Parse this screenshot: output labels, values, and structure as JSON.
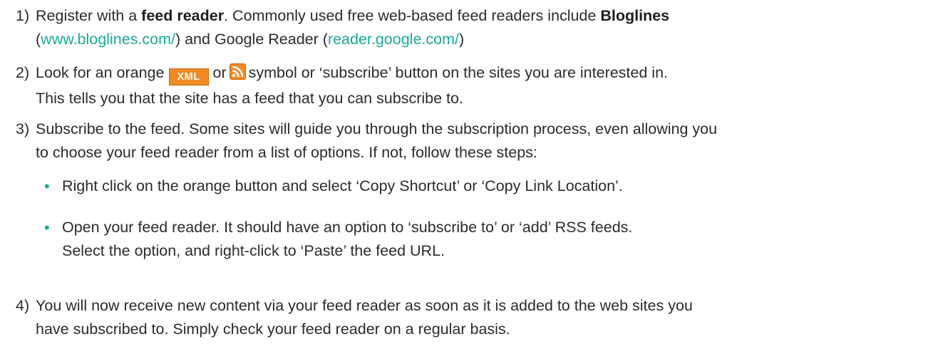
{
  "steps": [
    {
      "number": "1)",
      "line1_a": "Register with a ",
      "line1_b": "feed reader",
      "line1_c": ". Commonly used free web-based feed readers include ",
      "line1_d": "Bloglines",
      "line2_a": "(",
      "link1": "www.bloglines.com/",
      "line2_b": ") and Google Reader (",
      "link2": "reader.google.com/",
      "line2_c": ")"
    },
    {
      "number": "2)",
      "line1_a": "Look for an orange",
      "xml_badge": "XML",
      "line1_b": "or",
      "line1_c": "symbol or ‘subscribe’ button on the sites you are interested in.",
      "line2": "This tells you that the site has a feed that you can subscribe to."
    },
    {
      "number": "3)",
      "line1": "Subscribe to the feed. Some sites will guide you through the subscription process, even allowing you",
      "line2": "to choose your feed reader from a list of options. If not, follow these steps:",
      "bullets": [
        {
          "line1": "Right click on the orange button and select ‘Copy Shortcut’ or ‘Copy Link Location’."
        },
        {
          "line1": "Open your feed reader. It should have an option to ‘subscribe to’ or ‘add’ RSS feeds.",
          "line2": "Select the option, and right-click to ‘Paste’ the feed URL."
        }
      ]
    },
    {
      "number": "4)",
      "line1": "You will now receive new content via your feed reader as soon as it is added to the web sites you",
      "line2": "have subscribed to. Simply check your feed reader on a regular basis."
    }
  ],
  "bullet_glyph": "•",
  "colors": {
    "text": "#2b2b2b",
    "link": "#19a99b",
    "rss_orange": "#f08a24"
  },
  "icons": {
    "rss": "rss-feed-icon"
  }
}
